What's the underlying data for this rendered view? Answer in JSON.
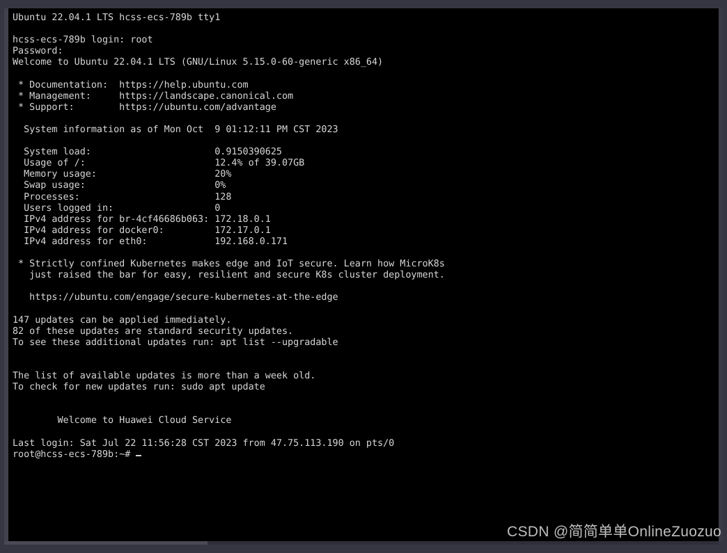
{
  "window": {
    "chrome_color": "#363643",
    "screen_background": "#000000",
    "text_color": "#d6d6d6"
  },
  "terminal": {
    "title_line": "Ubuntu 22.04.1 LTS hcss-ecs-789b tty1",
    "hostname": "hcss-ecs-789b",
    "lines": [
      "Ubuntu 22.04.1 LTS hcss-ecs-789b tty1",
      "",
      "hcss-ecs-789b login: root",
      "Password:",
      "Welcome to Ubuntu 22.04.1 LTS (GNU/Linux 5.15.0-60-generic x86_64)",
      "",
      " * Documentation:  https://help.ubuntu.com",
      " * Management:     https://landscape.canonical.com",
      " * Support:        https://ubuntu.com/advantage",
      "",
      "  System information as of Mon Oct  9 01:12:11 PM CST 2023",
      "",
      "  System load:                      0.9150390625",
      "  Usage of /:                       12.4% of 39.07GB",
      "  Memory usage:                     20%",
      "  Swap usage:                       0%",
      "  Processes:                        128",
      "  Users logged in:                  0",
      "  IPv4 address for br-4cf46686b063: 172.18.0.1",
      "  IPv4 address for docker0:         172.17.0.1",
      "  IPv4 address for eth0:            192.168.0.171",
      "",
      " * Strictly confined Kubernetes makes edge and IoT secure. Learn how MicroK8s",
      "   just raised the bar for easy, resilient and secure K8s cluster deployment.",
      "",
      "   https://ubuntu.com/engage/secure-kubernetes-at-the-edge",
      "",
      "147 updates can be applied immediately.",
      "82 of these updates are standard security updates.",
      "To see these additional updates run: apt list --upgradable",
      "",
      "",
      "The list of available updates is more than a week old.",
      "To check for new updates run: sudo apt update",
      "",
      "",
      "        Welcome to Huawei Cloud Service",
      "",
      "Last login: Sat Jul 22 11:56:28 CST 2023 from 47.75.113.190 on pts/0"
    ],
    "prompt": "root@hcss-ecs-789b:~#",
    "login_user": "root",
    "password_prompt": "Password:",
    "os_release": "Ubuntu 22.04.1 LTS",
    "kernel": "GNU/Linux 5.15.0-60-generic x86_64",
    "links": {
      "documentation": "https://help.ubuntu.com",
      "management": "https://landscape.canonical.com",
      "support": "https://ubuntu.com/advantage",
      "microk8s": "https://ubuntu.com/engage/secure-kubernetes-at-the-edge"
    },
    "system_information": {
      "timestamp": "Mon Oct  9 01:12:11 PM CST 2023",
      "system_load": "0.9150390625",
      "usage_of_root": "12.4% of 39.07GB",
      "memory_usage": "20%",
      "swap_usage": "0%",
      "processes": "128",
      "users_logged_in": "0",
      "ipv4_br": "172.18.0.1",
      "ipv4_docker0": "172.17.0.1",
      "ipv4_eth0": "192.168.0.171"
    },
    "updates": {
      "immediate": "147 updates can be applied immediately.",
      "security": "82 of these updates are standard security updates.",
      "list_command": "To see these additional updates run: apt list --upgradable",
      "stale_notice": "The list of available updates is more than a week old.",
      "refresh_command": "To check for new updates run: sudo apt update"
    },
    "banner": "        Welcome to Huawei Cloud Service",
    "last_login": "Last login: Sat Jul 22 11:56:28 CST 2023 from 47.75.113.190 on pts/0"
  },
  "scrollbar": {
    "orientation": "horizontal",
    "thumb_color": "#4a4a57",
    "track_color": "#2f2f3a"
  },
  "watermark": {
    "text": "CSDN @简简单单OnlineZuozuo"
  }
}
